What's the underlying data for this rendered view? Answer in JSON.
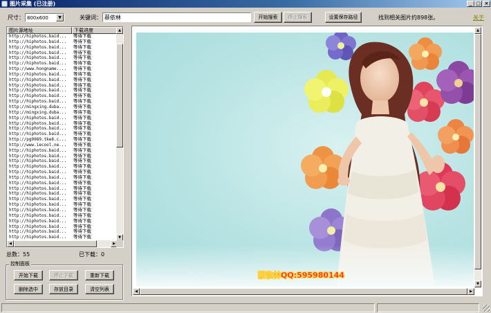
{
  "window": {
    "title": "图片采集 (已注册)",
    "minimize": "_",
    "maximize": "□",
    "close": "×"
  },
  "toolbar": {
    "size_label": "尺寸：",
    "size_value": "800x600",
    "keyword_label": "关键词：",
    "keyword_value": "蔡依林",
    "start_search": "开始搜索",
    "stop_search": "停止搜索",
    "set_path": "设置保存路径",
    "result_text": "找到相关图片约898张。",
    "about": "关于"
  },
  "list": {
    "col_url": "图片源地址",
    "col_status": "下载进度",
    "rows": [
      {
        "url": "http://hiphotos.baid...",
        "status": "等待下载"
      },
      {
        "url": "http://hiphotos.baid...",
        "status": "等待下载"
      },
      {
        "url": "http://hiphotos.baid...",
        "status": "等待下载"
      },
      {
        "url": "http://hiphotos.baid...",
        "status": "等待下载"
      },
      {
        "url": "http://hiphotos.baid...",
        "status": "等待下载"
      },
      {
        "url": "http://hiphotos.baid...",
        "status": "等待下载"
      },
      {
        "url": "http://www.hongname....",
        "status": "等待下载"
      },
      {
        "url": "http://hiphotos.baid...",
        "status": "等待下载"
      },
      {
        "url": "http://hiphotos.baid...",
        "status": "等待下载"
      },
      {
        "url": "http://hiphotos.baid...",
        "status": "等待下载"
      },
      {
        "url": "http://hiphotos.baid...",
        "status": "等待下载"
      },
      {
        "url": "http://hiphotos.baid...",
        "status": "等待下载"
      },
      {
        "url": "http://hiphotos.baid...",
        "status": "等待下载"
      },
      {
        "url": "http://mingxing.duba...",
        "status": "等待下载"
      },
      {
        "url": "http://mingxing.duba...",
        "status": "等待下载"
      },
      {
        "url": "http://hiphotos.baid...",
        "status": "等待下载"
      },
      {
        "url": "http://hiphotos.baid...",
        "status": "等待下载"
      },
      {
        "url": "http://hiphotos.baid...",
        "status": "等待下载"
      },
      {
        "url": "http://hiphotos.baid...",
        "status": "等待下载"
      },
      {
        "url": "http://pg9989.tke8.c...",
        "status": "等待下载"
      },
      {
        "url": "http://www.iecool.ne...",
        "status": "等待下载"
      },
      {
        "url": "http://hiphotos.baid...",
        "status": "等待下载"
      },
      {
        "url": "http://hiphotos.baid...",
        "status": "等待下载"
      },
      {
        "url": "http://hiphotos.baid...",
        "status": "等待下载"
      },
      {
        "url": "http://hiphotos.baid...",
        "status": "等待下载"
      },
      {
        "url": "http://hiphotos.baid...",
        "status": "等待下载"
      },
      {
        "url": "http://hiphotos.baid...",
        "status": "等待下载"
      },
      {
        "url": "http://hiphotos.baid...",
        "status": "等待下载"
      },
      {
        "url": "http://hiphotos.baid...",
        "status": "等待下载"
      },
      {
        "url": "http://hiphotos.baid...",
        "status": "等待下载"
      },
      {
        "url": "http://hiphotos.baid...",
        "status": "等待下载"
      },
      {
        "url": "http://hiphotos.baid...",
        "status": "等待下载"
      },
      {
        "url": "http://hiphotos.baid...",
        "status": "等待下载"
      },
      {
        "url": "http://hiphotos.baid...",
        "status": "等待下载"
      },
      {
        "url": "http://hiphotos.baid...",
        "status": "等待下载"
      },
      {
        "url": "http://hiphotos.baid...",
        "status": "等待下载"
      },
      {
        "url": "http://hiphotos.baid...",
        "status": "等待下载"
      },
      {
        "url": "http://hiphotos.baid...",
        "status": "等待下载"
      }
    ]
  },
  "stats": {
    "total": "总数：55",
    "downloaded": "已下载：0"
  },
  "control": {
    "title": "控制面板",
    "start_download": "开始下载",
    "stop_download": "停止下载",
    "redownload": "重新下载",
    "delete_selected": "删除选中",
    "open_dir": "存放目录",
    "clear_list": "清空列表"
  },
  "preview": {
    "watermark": "蔡依林QQ:595980144"
  },
  "colors": {
    "face": "#d4d0c8",
    "title_active": "#0a246a",
    "about_link": "#808000",
    "watermark": "#ff2a2a"
  },
  "scroll": {
    "list_position": 0.1,
    "preview_position": 0.0
  }
}
